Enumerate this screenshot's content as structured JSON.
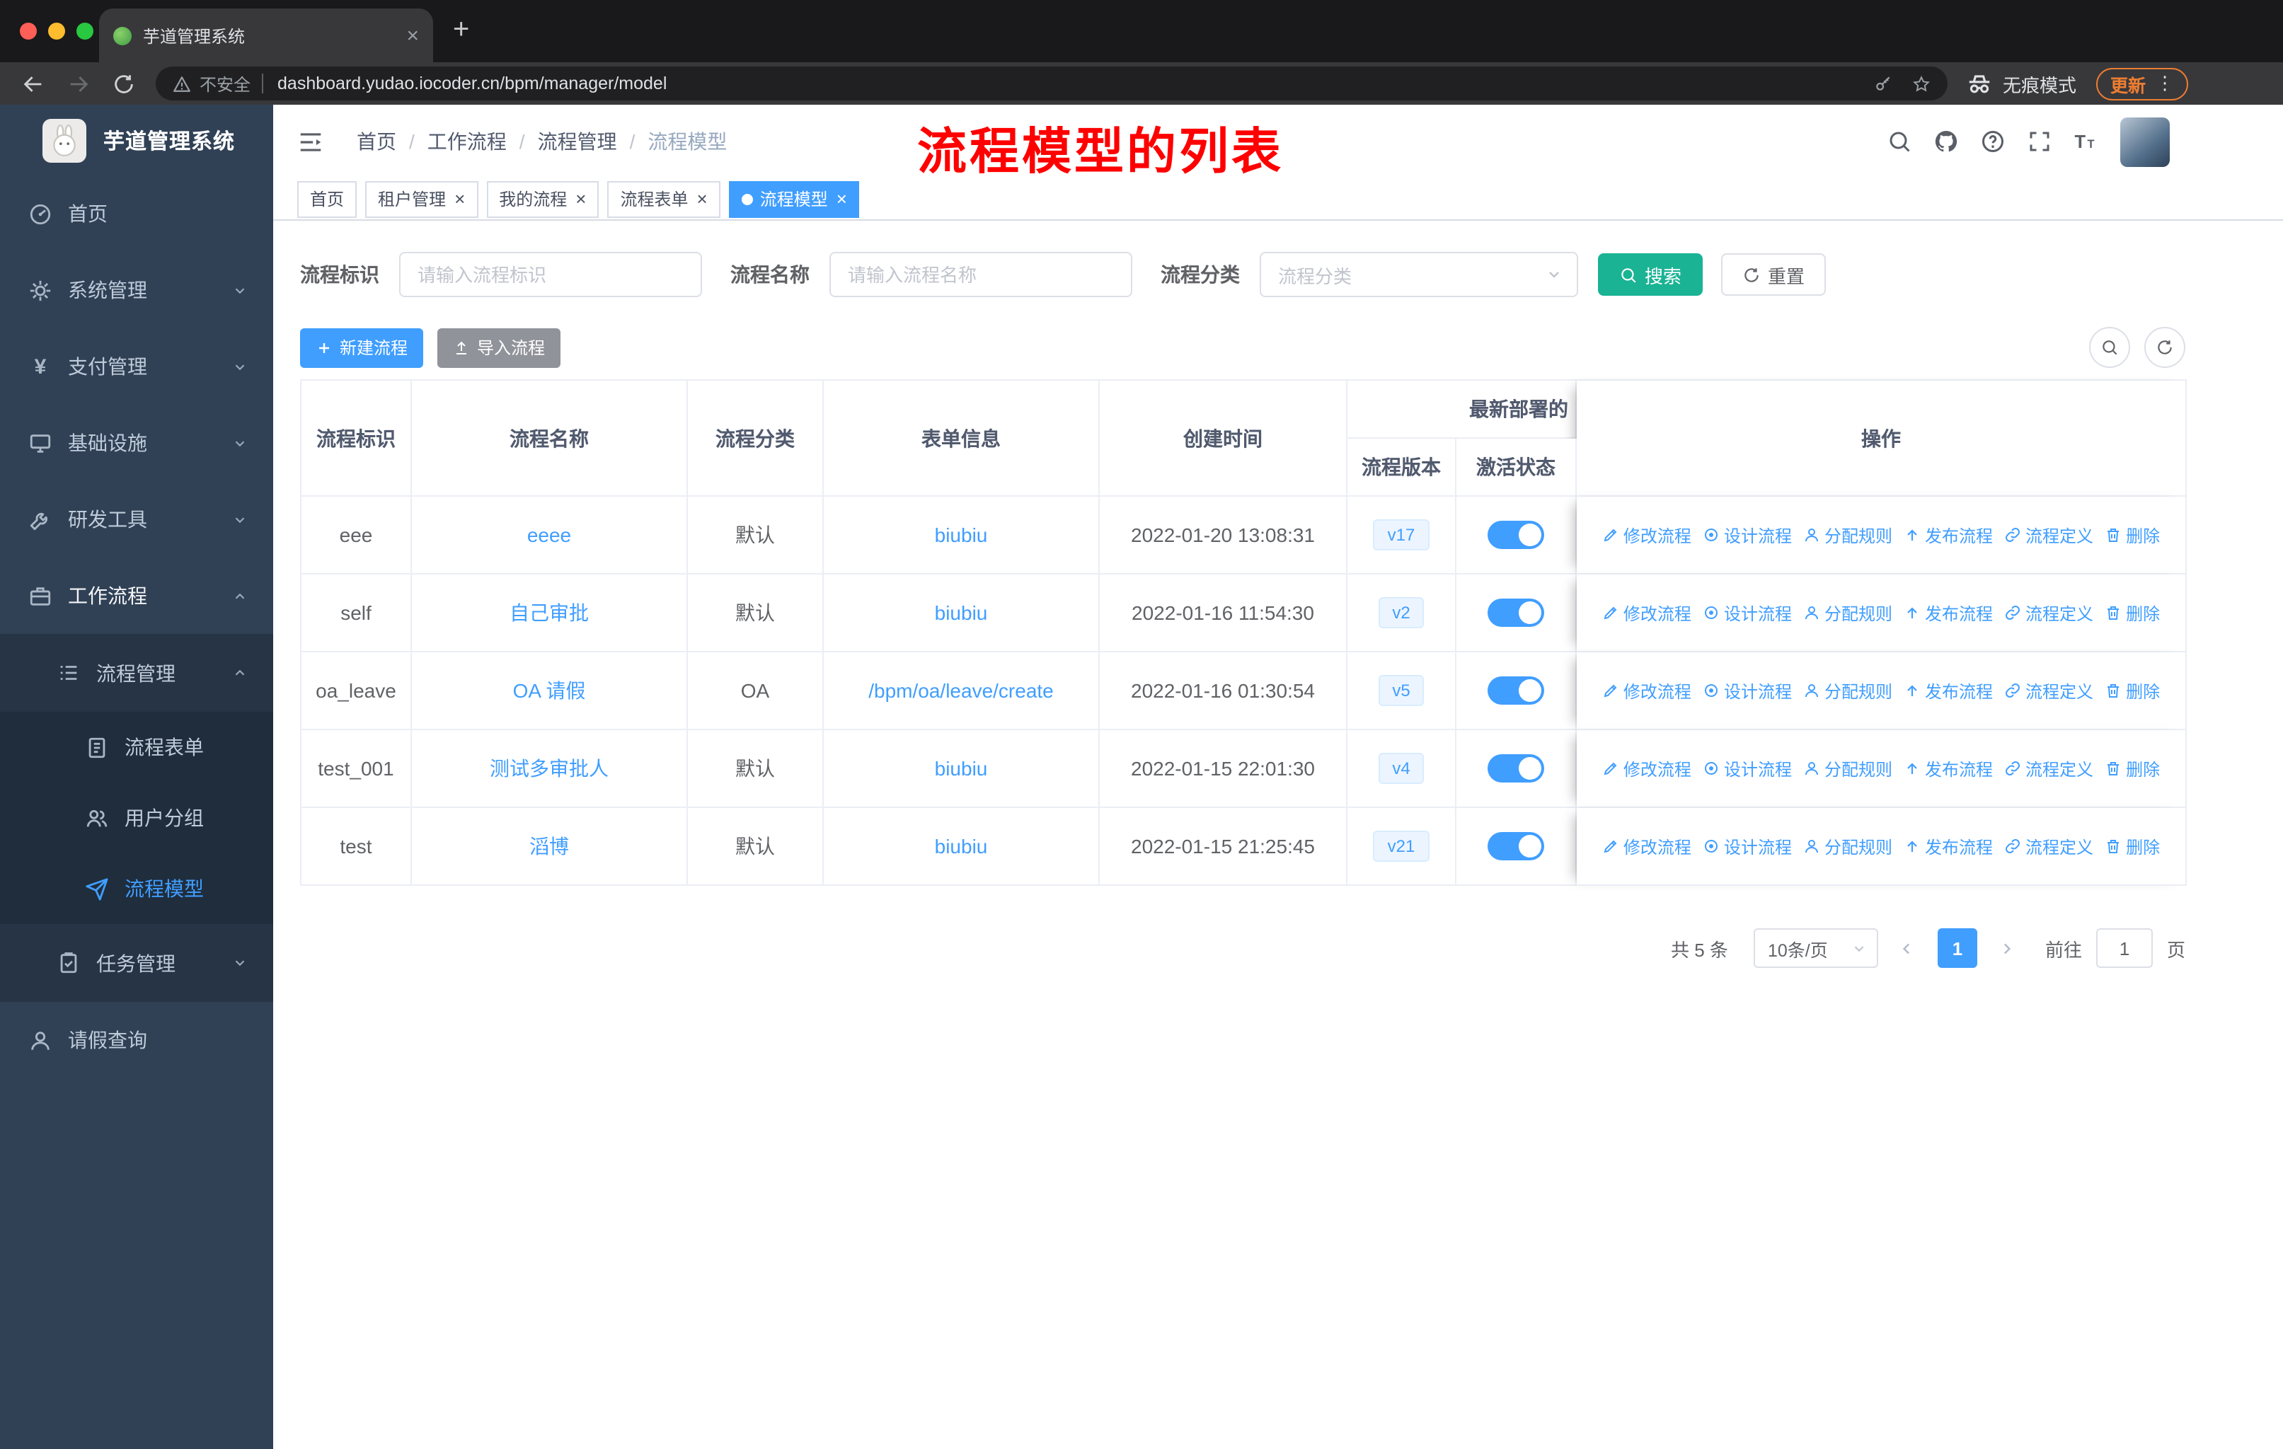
{
  "theme": {
    "primary": "#409eff",
    "success": "#1ab394",
    "info": "#909399",
    "annotation": "#fe0000",
    "sidebar_bg": "#304156",
    "sidebar_sub_bg": "#263445",
    "sidebar_leaf_bg": "#1f2d3d",
    "sidebar_text": "#bfcbd9"
  },
  "browser": {
    "tab": {
      "title": "芋道管理系统"
    },
    "toolbar": {
      "security_label": "不安全",
      "url": "dashboard.yudao.iocoder.cn/bpm/manager/model",
      "incognito_label": "无痕模式",
      "update_label": "更新"
    }
  },
  "sidebar": {
    "logo_title": "芋道管理系统",
    "items": {
      "home": "首页",
      "system": "系统管理",
      "pay": "支付管理",
      "infra": "基础设施",
      "dev": "研发工具",
      "workflow": "工作流程",
      "process_mgmt": "流程管理",
      "process_form": "流程表单",
      "user_group": "用户分组",
      "process_model": "流程模型",
      "task_mgmt": "任务管理",
      "leave_query": "请假查询"
    }
  },
  "header": {
    "breadcrumb": [
      "首页",
      "工作流程",
      "流程管理",
      "流程模型"
    ],
    "separator": "/",
    "annotation": "流程模型的列表"
  },
  "tags": [
    {
      "label": "首页",
      "closable": false,
      "active": false
    },
    {
      "label": "租户管理",
      "closable": true,
      "active": false
    },
    {
      "label": "我的流程",
      "closable": true,
      "active": false
    },
    {
      "label": "流程表单",
      "closable": true,
      "active": false
    },
    {
      "label": "流程模型",
      "closable": true,
      "active": true
    }
  ],
  "filters": {
    "key_label": "流程标识",
    "key_placeholder": "请输入流程标识",
    "name_label": "流程名称",
    "name_placeholder": "请输入流程名称",
    "category_label": "流程分类",
    "category_placeholder": "流程分类",
    "search_button": "搜索",
    "reset_button": "重置"
  },
  "actions": {
    "create_button": "新建流程",
    "import_button": "导入流程"
  },
  "table": {
    "headers": {
      "key": "流程标识",
      "name": "流程名称",
      "category": "流程分类",
      "form": "表单信息",
      "create_time": "创建时间",
      "deploy_group": "最新部署的",
      "version": "流程版本",
      "state": "激活状态",
      "ops": "操作"
    },
    "row_actions": [
      "修改流程",
      "设计流程",
      "分配规则",
      "发布流程",
      "流程定义",
      "删除"
    ],
    "rows": [
      {
        "key": "eee",
        "name": "eeee",
        "category": "默认",
        "form": "biubiu",
        "create_time": "2022-01-20 13:08:31",
        "version": "v17",
        "active": true
      },
      {
        "key": "self",
        "name": "自己审批",
        "category": "默认",
        "form": "biubiu",
        "create_time": "2022-01-16 11:54:30",
        "version": "v2",
        "active": true
      },
      {
        "key": "oa_leave",
        "name": "OA 请假",
        "category": "OA",
        "form": "/bpm/oa/leave/create",
        "create_time": "2022-01-16 01:30:54",
        "version": "v5",
        "active": true
      },
      {
        "key": "test_001",
        "name": "测试多审批人",
        "category": "默认",
        "form": "biubiu",
        "create_time": "2022-01-15 22:01:30",
        "version": "v4",
        "active": true
      },
      {
        "key": "test",
        "name": "滔博",
        "category": "默认",
        "form": "biubiu",
        "create_time": "2022-01-15 21:25:45",
        "version": "v21",
        "active": true
      }
    ]
  },
  "pagination": {
    "total": "共 5 条",
    "page_size": "10条/页",
    "current_page": "1",
    "goto_label": "前往",
    "goto_value": "1",
    "page_suffix": "页"
  }
}
